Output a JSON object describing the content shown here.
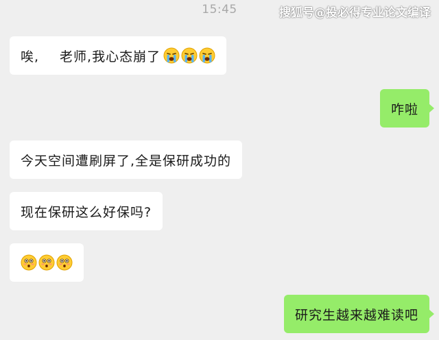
{
  "header": {
    "time": "15:45",
    "watermark": "搜狐号@投必得专业论文编译"
  },
  "messages": [
    {
      "side": "left",
      "text_a": "唉,",
      "text_b": "老师,我心态崩了",
      "emoji": [
        "crying-face",
        "crying-face",
        "crying-face"
      ]
    },
    {
      "side": "right",
      "text": "咋啦"
    },
    {
      "side": "left",
      "text": "今天空间遭刷屏了,全是保研成功的"
    },
    {
      "side": "left",
      "text": "现在保研这么好保吗?"
    },
    {
      "side": "left",
      "emoji": [
        "astonished-face",
        "astonished-face",
        "astonished-face"
      ]
    },
    {
      "side": "right",
      "text": "研究生越来越难读吧"
    }
  ],
  "colors": {
    "background": "#efefef",
    "left_bubble": "#ffffff",
    "right_bubble": "#95ec69",
    "timestamp": "#a8a8a8"
  }
}
